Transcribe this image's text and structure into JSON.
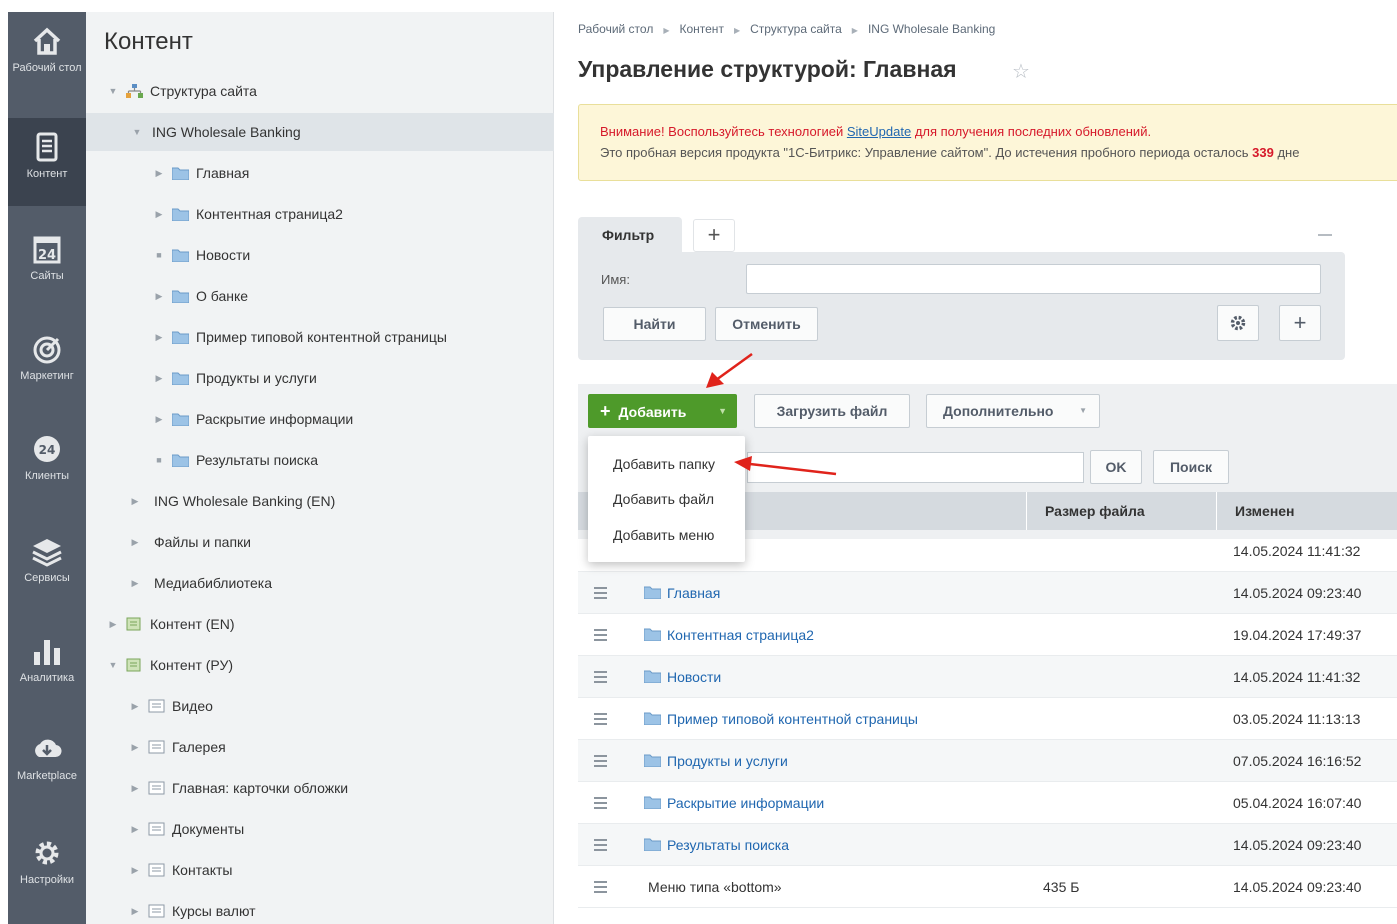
{
  "sidebar": {
    "items": [
      {
        "label": "Рабочий стол",
        "icon": "home-icon"
      },
      {
        "label": "Контент",
        "icon": "document-icon"
      },
      {
        "label": "Сайты",
        "icon": "calendar-icon"
      },
      {
        "label": "Маркетинг",
        "icon": "target-icon"
      },
      {
        "label": "Клиенты",
        "icon": "crm-icon"
      },
      {
        "label": "Сервисы",
        "icon": "layers-icon"
      },
      {
        "label": "Аналитика",
        "icon": "bar-chart-icon"
      },
      {
        "label": "Marketplace",
        "icon": "cloud-download-icon"
      },
      {
        "label": "Настройки",
        "icon": "gear-icon"
      }
    ]
  },
  "tree": {
    "title": "Контент",
    "items": [
      {
        "label": "Структура сайта"
      },
      {
        "label": "ING Wholesale Banking"
      },
      {
        "label": "Главная"
      },
      {
        "label": "Контентная страница2"
      },
      {
        "label": "Новости"
      },
      {
        "label": "О банке"
      },
      {
        "label": "Пример типовой контентной страницы"
      },
      {
        "label": "Продукты и услуги"
      },
      {
        "label": "Раскрытие информации"
      },
      {
        "label": "Результаты поиска"
      },
      {
        "label": "ING Wholesale Banking (EN)"
      },
      {
        "label": "Файлы и папки"
      },
      {
        "label": "Медиабиблиотека"
      },
      {
        "label": "Контент (EN)"
      },
      {
        "label": "Контент (РУ)"
      },
      {
        "label": "Видео"
      },
      {
        "label": "Галерея"
      },
      {
        "label": "Главная: карточки обложки"
      },
      {
        "label": "Документы"
      },
      {
        "label": "Контакты"
      },
      {
        "label": "Курсы валют"
      }
    ]
  },
  "breadcrumbs": [
    "Рабочий стол",
    "Контент",
    "Структура сайта",
    "ING Wholesale Banking"
  ],
  "page": {
    "title": "Управление структурой: Главная"
  },
  "notice": {
    "line1_prefix": "Внимание! Воспользуйтесь технологией ",
    "line1_link": "SiteUpdate",
    "line1_suffix": " для получения последних обновлений.",
    "line2": "Это пробная версия продукта \"1С-Битрикс: Управление сайтом\". До истечения пробного периода осталось ",
    "days": "339",
    "line2_end": " дне"
  },
  "filter": {
    "tab_label": "Фильтр",
    "name_label": "Имя:",
    "name_value": "",
    "find_label": "Найти",
    "cancel_label": "Отменить"
  },
  "toolbar": {
    "add_label": "Добавить",
    "upload_label": "Загрузить файл",
    "more_label": "Дополнительно",
    "ok_label": "OK",
    "search_label": "Поиск"
  },
  "add_menu": [
    "Добавить папку",
    "Добавить файл",
    "Добавить меню"
  ],
  "table": {
    "headers": {
      "size": "Размер файла",
      "modified": "Изменен"
    },
    "rows": [
      {
        "name": "",
        "size": "",
        "date": "14.05.2024 11:41:32"
      },
      {
        "name": "Главная",
        "size": "",
        "date": "14.05.2024 09:23:40"
      },
      {
        "name": "Контентная страница2",
        "size": "",
        "date": "19.04.2024 17:49:37"
      },
      {
        "name": "Новости",
        "size": "",
        "date": "14.05.2024 11:41:32"
      },
      {
        "name": "Пример типовой контентной страницы",
        "size": "",
        "date": "03.05.2024 11:13:13"
      },
      {
        "name": "Продукты и услуги",
        "size": "",
        "date": "07.05.2024 16:16:52"
      },
      {
        "name": "Раскрытие информации",
        "size": "",
        "date": "05.04.2024 16:07:40"
      },
      {
        "name": "Результаты поиска",
        "size": "",
        "date": "14.05.2024 09:23:40"
      },
      {
        "name": "Меню типа «bottom»",
        "size": "435 Б",
        "date": "14.05.2024 09:23:40"
      }
    ]
  },
  "colors": {
    "sidebar": "#535c69",
    "add_button": "#4e9a2a",
    "link": "#2067b0",
    "annotation_arrow": "#e0231b"
  }
}
